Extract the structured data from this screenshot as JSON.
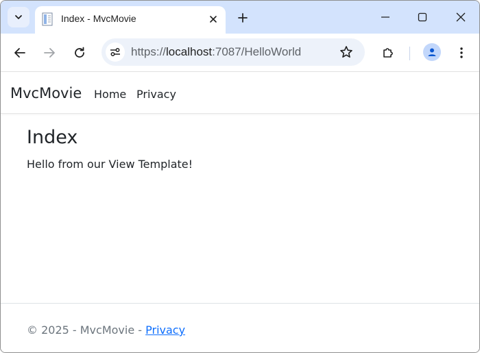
{
  "browser": {
    "tab": {
      "title": "Index - MvcMovie"
    },
    "omnibox": {
      "url_prefix": "https://",
      "url_host": "localhost",
      "url_rest": ":7087/HelloWorld"
    }
  },
  "page": {
    "brand": "MvcMovie",
    "nav": [
      {
        "label": "Home"
      },
      {
        "label": "Privacy"
      }
    ],
    "heading": "Index",
    "message": "Hello from our View Template!",
    "footer": {
      "text": "© 2025 - MvcMovie - ",
      "link": "Privacy"
    }
  },
  "icons": {
    "tab_search": "chevron-down-icon",
    "favicon": "page-icon",
    "tab_close": "close-icon",
    "new_tab": "plus-icon",
    "back": "arrow-left-icon",
    "forward": "arrow-right-icon",
    "reload": "reload-icon",
    "site_info": "tune-icon",
    "bookmark": "star-icon",
    "extensions": "puzzle-icon",
    "profile": "person-icon",
    "menu": "more-vert-icon"
  },
  "colors": {
    "tabstrip": "#d3e3fd",
    "omnibox": "#edf2fa",
    "link": "#0d6efd",
    "text": "#212529",
    "muted": "#6c757d"
  }
}
